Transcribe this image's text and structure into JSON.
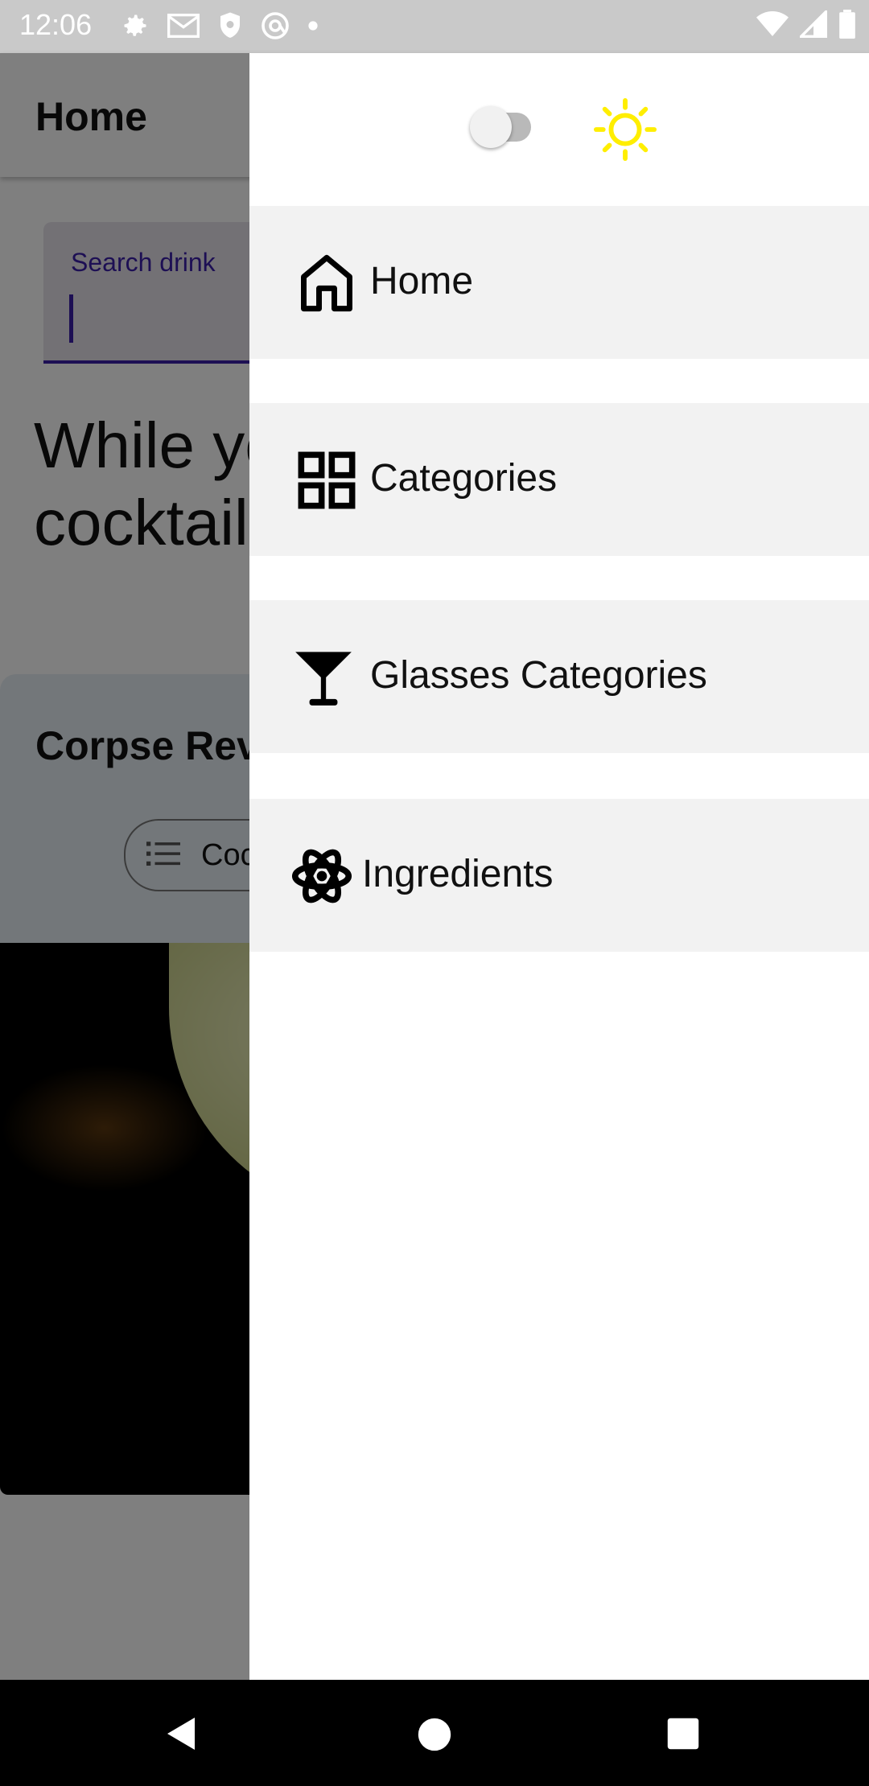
{
  "status_bar": {
    "time": "12:06",
    "left_icons": [
      "settings-icon",
      "gmail-icon",
      "shield-icon",
      "at-sign-icon",
      "dot-icon"
    ],
    "right_icons": [
      "wifi-icon",
      "cellular-icon",
      "battery-icon"
    ]
  },
  "app": {
    "title": "Home",
    "search": {
      "label": "Search drink",
      "value": ""
    },
    "intro_text": "While you decide what cocktail, heres random:",
    "card": {
      "title": "Corpse Reviver",
      "chip_label": "Cocktail"
    }
  },
  "drawer": {
    "theme_toggle": {
      "on": false
    },
    "theme_icon": "sun-icon",
    "sun_color": "#ffee00",
    "items": [
      {
        "label": "Home",
        "icon": "home-icon"
      },
      {
        "label": "Categories",
        "icon": "grid-icon"
      },
      {
        "label": "Glasses Categories",
        "icon": "cocktail-glass-icon"
      },
      {
        "label": "Ingredients",
        "icon": "atom-icon"
      }
    ]
  },
  "nav_bar": {
    "buttons": [
      "back-icon",
      "home-circle-icon",
      "recents-square-icon"
    ]
  }
}
